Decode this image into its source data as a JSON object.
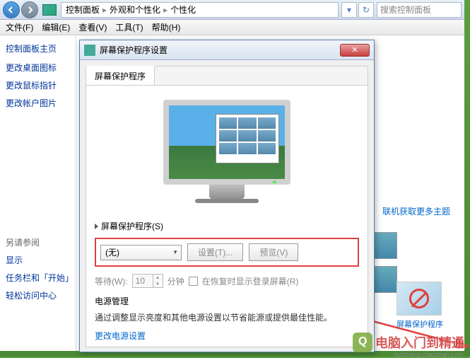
{
  "breadcrumb": {
    "item1": "控制面板",
    "item2": "外观和个性化",
    "item3": "个性化"
  },
  "search": {
    "placeholder": "搜索控制面板"
  },
  "menubar": {
    "file": "文件(F)",
    "edit": "编辑(E)",
    "view": "查看(V)",
    "tools": "工具(T)",
    "help": "帮助(H)"
  },
  "sidebar": {
    "home": "控制面板主页",
    "links": [
      "更改桌面图标",
      "更改鼠标指针",
      "更改帐户图片"
    ],
    "seealso_title": "另请参阅",
    "seealso": [
      "显示",
      "任务栏和「开始」",
      "轻松访问中心"
    ]
  },
  "rightpane": {
    "online_themes": "联机获取更多主题",
    "screensaver_label": "屏幕保护程序"
  },
  "dialog": {
    "title": "屏幕保护程序设置",
    "tab": "屏幕保护程序",
    "section_label": "屏幕保护程序(S)",
    "dropdown_value": "(无)",
    "settings_btn": "设置(T)...",
    "preview_btn": "预览(V)",
    "wait_label": "等待(W):",
    "wait_value": "10",
    "wait_unit": "分钟",
    "resume_checkbox": "在恢复时显示登录屏幕(R)",
    "power_title": "电源管理",
    "power_desc": "通过调整显示亮度和其他电源设置以节省能源或提供最佳性能。",
    "power_link": "更改电源设置"
  },
  "watermark": {
    "main": "电脑入门到精通",
    "sub": "jiaocheng.chazidian.com"
  }
}
